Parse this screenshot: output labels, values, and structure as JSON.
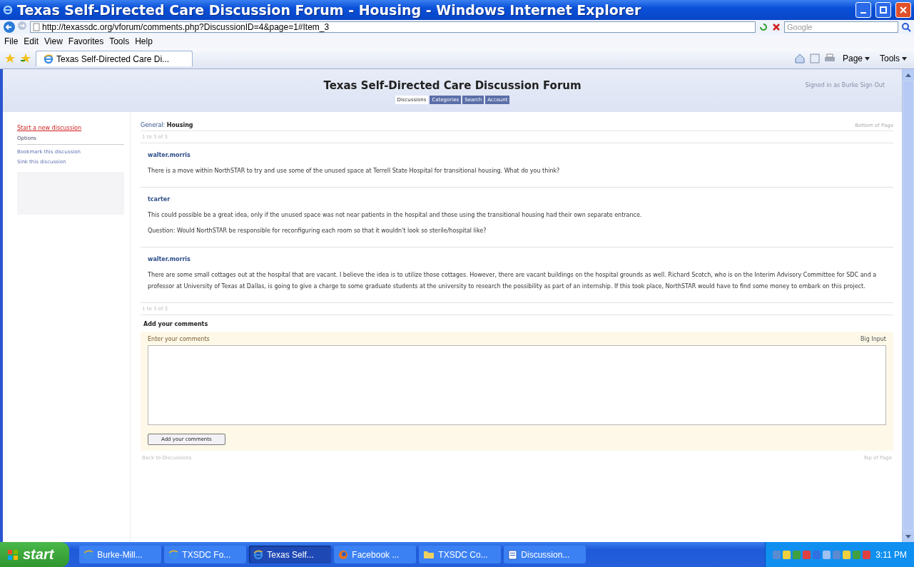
{
  "window": {
    "title": "Texas Self-Directed Care Discussion Forum - Housing - Windows Internet Explorer"
  },
  "address_bar": {
    "url": "http://texassdc.org/vforum/comments.php?DiscussionID=4&page=1#Item_3",
    "search_placeholder": "Google"
  },
  "menu": [
    "File",
    "Edit",
    "View",
    "Favorites",
    "Tools",
    "Help"
  ],
  "browser_tabs": [
    {
      "label": "Texas Self-Directed Care Di...",
      "selected": true
    }
  ],
  "command_bar": [
    "Page",
    "Tools"
  ],
  "forum": {
    "title": "Texas Self-Directed Care Discussion Forum",
    "signed_in": "Signed in as Burke Sign Out",
    "tabs": [
      {
        "label": "Discussions",
        "selected": true
      },
      {
        "label": "Categories",
        "selected": false
      },
      {
        "label": "Search",
        "selected": false
      },
      {
        "label": "Account",
        "selected": false
      }
    ],
    "sidebar": {
      "start_link": "Start a new discussion",
      "options_heading": "Options",
      "options": [
        "Bookmark this discussion",
        "Sink this discussion"
      ]
    },
    "category": "General:",
    "topic": "Housing",
    "bottom_link": "Bottom of Page",
    "pager_top": "1 to 3 of 3",
    "comments": [
      {
        "author": "walter.morris",
        "lines": [
          "There is a move within NorthSTAR to try and use some of the unused space at Terrell State Hospital for transitional housing. What do you think?"
        ]
      },
      {
        "author": "tcarter",
        "lines": [
          "This could possible be a great idea, only if the unused space was not near patients in the hospital and those using the transitional housing had their own separate entrance.",
          "Question: Would NorthSTAR be responsible for reconfiguring each room so that it wouldn't look so sterile/hospital like?"
        ]
      },
      {
        "author": "walter.morris",
        "lines": [
          "There are some small cottages out at the hospital that are vacant. I believe the idea is to utilize those cottages. However, there are vacant buildings on the hospital grounds as well. Richard Scotch, who is on the Interim Advisory Committee for SDC and a professor at University of Texas at Dallas, is going to give a charge to some graduate students at the university to research the possibility as part of an internship. If this took place, NorthSTAR would have to find some money to embark on this project."
        ]
      }
    ],
    "pager_bottom": "1 to 3 of 3",
    "add_heading": "Add your comments",
    "form": {
      "label": "Enter your comments",
      "big_input": "Big Input",
      "button": "Add your comments"
    },
    "back_link": "Back to Discussions",
    "top_link": "Top of Page"
  },
  "taskbar": {
    "start": "start",
    "items": [
      {
        "label": "Burke-Mill...",
        "kind": "ie",
        "selected": false
      },
      {
        "label": "TXSDC Fo...",
        "kind": "ie",
        "selected": false
      },
      {
        "label": "Texas Self...",
        "kind": "ie",
        "selected": true
      },
      {
        "label": "Facebook ...",
        "kind": "firefox",
        "selected": false
      },
      {
        "label": "TXSDC Co...",
        "kind": "folder",
        "selected": false
      },
      {
        "label": "Discussion...",
        "kind": "document",
        "selected": false
      }
    ],
    "clock": "3:11 PM"
  }
}
